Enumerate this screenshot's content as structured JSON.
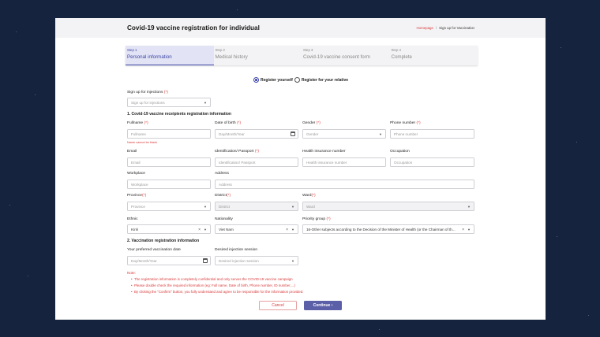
{
  "header": {
    "title": "Covid-19 vaccine registration for individual",
    "breadcrumb": {
      "home": "Homepage",
      "separator": "/",
      "current": "Sign up for Vaccination"
    }
  },
  "steps": [
    {
      "num": "Step 1",
      "label": "Personal information",
      "active": true
    },
    {
      "num": "Step 2",
      "label": "Medical history",
      "active": false
    },
    {
      "num": "Step 3",
      "label": "Covid-19 vaccine consent form",
      "active": false
    },
    {
      "num": "Step 4",
      "label": "Complete",
      "active": false
    }
  ],
  "registerFor": {
    "self": "Register yourself",
    "relative": "Register for your relative",
    "selected": "self"
  },
  "signup": {
    "label": "Sign up for injections",
    "placeholder": "Sign up for injections"
  },
  "section1": "1. Covid-19 vaccine receipients registration information",
  "fields": {
    "fullname": {
      "label": "Fullname",
      "placeholder": "Fullname",
      "error": "Name cannot be blank"
    },
    "dob": {
      "label": "Date of birth",
      "placeholder": "Day/Month/Year"
    },
    "gender": {
      "label": "Gender",
      "placeholder": "Gender"
    },
    "phone": {
      "label": "Phone number",
      "placeholder": "Phone number"
    },
    "email": {
      "label": "Email",
      "placeholder": "Email"
    },
    "idpassport": {
      "label": "Identification/ Passport",
      "placeholder": "Identification/ Passport"
    },
    "insurance": {
      "label": "Health insurance number",
      "placeholder": "Health insurance number"
    },
    "occupation": {
      "label": "Occupation",
      "placeholder": "Occupation"
    },
    "workplace": {
      "label": "Workplace",
      "placeholder": "Workplace"
    },
    "address": {
      "label": "Address",
      "placeholder": "Address"
    },
    "province": {
      "label": "Province",
      "placeholder": "Province"
    },
    "district": {
      "label": "District",
      "placeholder": "District"
    },
    "ward": {
      "label": "Ward",
      "placeholder": "Ward"
    },
    "ethnic": {
      "label": "Ethnic",
      "value": "Kinh"
    },
    "nationality": {
      "label": "Nationality",
      "value": "Viet Nam"
    },
    "priority": {
      "label": "Priority group",
      "value": "16-Other subjects according to the Decision of the Minister of Health (or the Chairman of th..."
    }
  },
  "section2": "2. Vaccination registration information",
  "vaccination": {
    "date": {
      "label": "Your preferred vaccination date",
      "placeholder": "Day/Month/Year"
    },
    "session": {
      "label": "Desired injection session",
      "placeholder": "Desired injection session"
    }
  },
  "note": {
    "title": "Note:",
    "items": [
      "The registration information is completely confidential and only serves the COVID-19 vaccine campaign",
      "Please double check the required information (eg: Full name, Date of birth, Phone number, ID number,...)",
      "By clicking the \"Confirm\" button, you fully understand and agree to be responsible for the information provided."
    ]
  },
  "buttons": {
    "cancel": "Cancel",
    "continue": "Continue",
    "continue_arrow": "›"
  },
  "required_mark": "(*)",
  "colors": {
    "accent": "#3e46a8",
    "error": "#d93a3a",
    "primary_button": "#5b5fa8",
    "background": "#16233f"
  }
}
